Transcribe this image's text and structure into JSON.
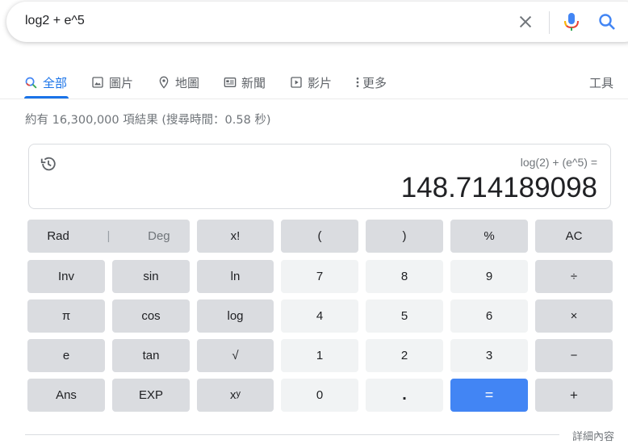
{
  "search": {
    "query": "log2 + e^5"
  },
  "tabs": [
    {
      "label": "全部"
    },
    {
      "label": "圖片"
    },
    {
      "label": "地圖"
    },
    {
      "label": "新聞"
    },
    {
      "label": "影片"
    },
    {
      "label": "更多"
    }
  ],
  "tools_label": "工具",
  "result_stats": "約有 16,300,000 項結果 (搜尋時間：0.58 秒)",
  "calculator": {
    "expression": "log(2) + (e^5) =",
    "result": "148.714189098",
    "keys": {
      "rad": "Rad",
      "separator": "|",
      "deg": "Deg",
      "factorial": "x!",
      "open_paren": "(",
      "close_paren": ")",
      "percent": "%",
      "clear": "AC",
      "inv": "Inv",
      "sin": "sin",
      "ln": "ln",
      "seven": "7",
      "eight": "8",
      "nine": "9",
      "divide": "÷",
      "pi": "π",
      "cos": "cos",
      "log": "log",
      "four": "4",
      "five": "5",
      "six": "6",
      "multiply": "×",
      "e": "e",
      "tan": "tan",
      "sqrt": "√",
      "one": "1",
      "two": "2",
      "three": "3",
      "minus": "−",
      "ans": "Ans",
      "exp": "EXP",
      "power_base": "x",
      "power_exp": "y",
      "zero": "0",
      "dot": ".",
      "equals": "=",
      "plus": "+"
    }
  },
  "more_info": "詳細內容",
  "colors": {
    "accent": "#1a73e8",
    "equals_key": "#4285f4",
    "dark_key": "#dadce0",
    "light_key": "#f1f3f4"
  }
}
